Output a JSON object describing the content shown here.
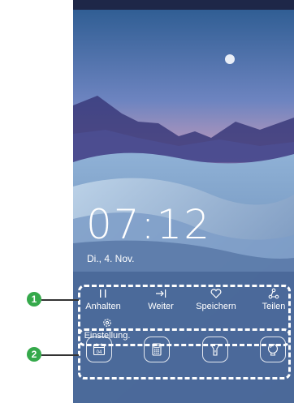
{
  "time": "07:12",
  "date": "Di., 4. Nov.",
  "actions": [
    {
      "label": "Anhalten",
      "icon": "pause-icon"
    },
    {
      "label": "Weiter",
      "icon": "skip-forward-icon"
    },
    {
      "label": "Speichern",
      "icon": "heart-icon"
    },
    {
      "label": "Teilen",
      "icon": "share-icon"
    },
    {
      "label": "Einstellung.",
      "icon": "settings-icon"
    }
  ],
  "tools": [
    {
      "icon": "calendar-icon",
      "day": "04"
    },
    {
      "icon": "calculator-icon"
    },
    {
      "icon": "flashlight-icon"
    },
    {
      "icon": "camera-icon"
    }
  ],
  "callouts": [
    "1",
    "2"
  ],
  "colors": {
    "callout_badge": "#35a94b",
    "dash_outline": "#ffffff"
  }
}
